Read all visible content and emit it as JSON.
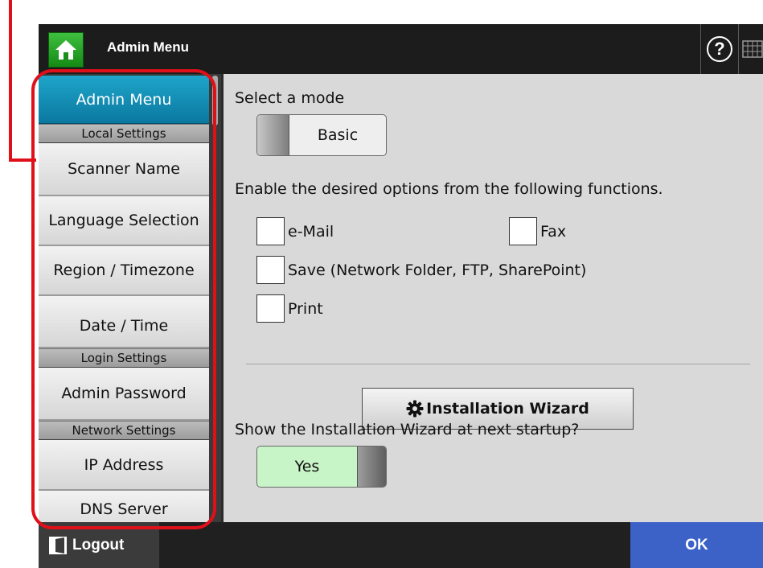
{
  "header": {
    "title": "Admin Menu",
    "help_label": "?"
  },
  "sidebar": {
    "active_item": "Admin Menu",
    "sections": [
      {
        "header": "Local Settings",
        "items": [
          "Scanner Name",
          "Language Selection",
          "Region / Timezone",
          "Date / Time"
        ]
      },
      {
        "header": "Login Settings",
        "items": [
          "Admin Password"
        ]
      },
      {
        "header": "Network Settings",
        "items": [
          "IP Address",
          "DNS Server"
        ]
      }
    ]
  },
  "main": {
    "mode_label": "Select a mode",
    "mode_value": "Basic",
    "options_label": "Enable the desired options from the following functions.",
    "options": {
      "email": {
        "label": "e-Mail",
        "checked": false
      },
      "fax": {
        "label": "Fax",
        "checked": false
      },
      "save": {
        "label": "Save (Network Folder, FTP, SharePoint)",
        "checked": false
      },
      "print": {
        "label": "Print",
        "checked": false
      }
    },
    "wizard_button_label": "Installation Wizard",
    "wizard_question": "Show the Installation Wizard at next startup?",
    "wizard_value": "Yes"
  },
  "footer": {
    "logout_label": "Logout",
    "ok_label": "OK"
  },
  "colors": {
    "active_item": "#0b78a0",
    "ok_button": "#3c62c8",
    "toggle_on": "#c8f5c8",
    "home_button": "#158a15",
    "highlight": "#e0101a"
  },
  "icons": {
    "home": "home-icon",
    "help": "help-icon",
    "keyboard": "keyboard-icon",
    "gear": "gear-icon",
    "logout": "logout-icon"
  }
}
